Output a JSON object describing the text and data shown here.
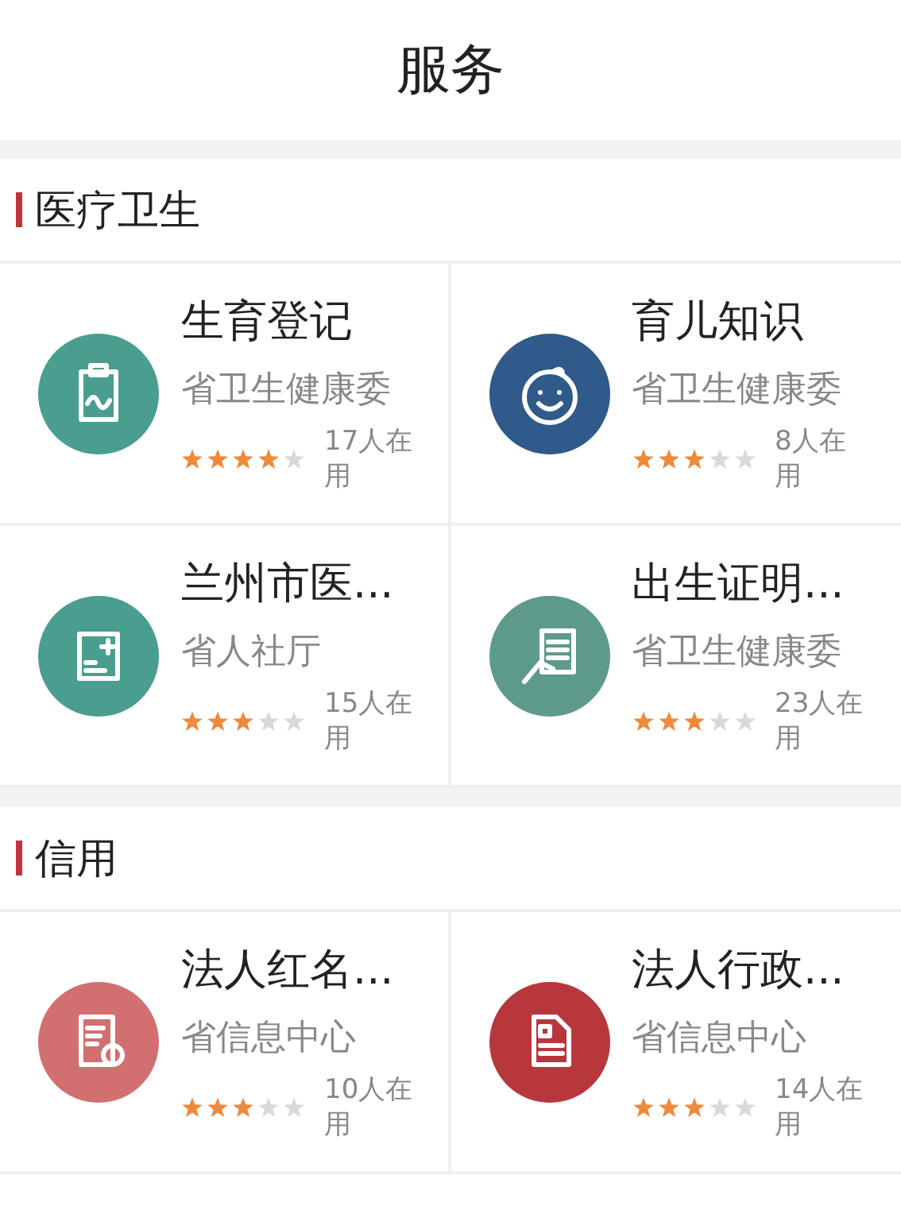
{
  "header": {
    "title": "服务"
  },
  "sections": [
    {
      "title": "医疗卫生",
      "items": [
        {
          "title": "生育登记",
          "org": "省卫生健康委",
          "stars": 4,
          "usage": "17人在用",
          "color": "#4a9e8f"
        },
        {
          "title": "育儿知识",
          "org": "省卫生健康委",
          "stars": 3,
          "usage": "8人在用",
          "color": "#2f5a8a"
        },
        {
          "title": "兰州市医...",
          "org": "省人社厅",
          "stars": 3,
          "usage": "15人在用",
          "color": "#4a9e8f"
        },
        {
          "title": "出生证明...",
          "org": "省卫生健康委",
          "stars": 3,
          "usage": "23人在用",
          "color": "#5e9a8c"
        }
      ]
    },
    {
      "title": "信用",
      "items": [
        {
          "title": "法人红名...",
          "org": "省信息中心",
          "stars": 3,
          "usage": "10人在用",
          "color": "#d26f71"
        },
        {
          "title": "法人行政...",
          "org": "省信息中心",
          "stars": 3,
          "usage": "14人在用",
          "color": "#b8373d"
        }
      ]
    }
  ]
}
